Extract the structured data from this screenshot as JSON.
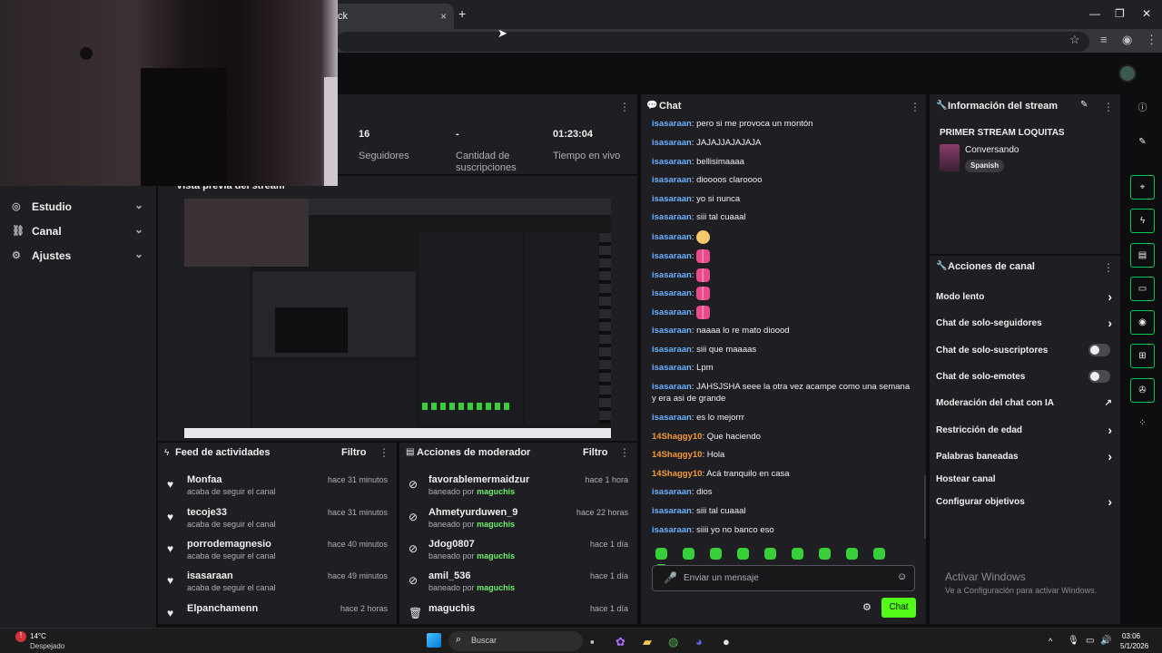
{
  "browser": {
    "tab_title": "ck",
    "tab_close": "×",
    "new_tab": "+",
    "window_controls": [
      "—",
      "❐",
      "✕"
    ]
  },
  "sidebar": {
    "items": [
      {
        "label": "Estudio",
        "icon": "broadcast-icon"
      },
      {
        "label": "Canal",
        "icon": "channel-icon"
      },
      {
        "label": "Ajustes",
        "icon": "gear-icon"
      }
    ]
  },
  "stats": [
    {
      "value": "16",
      "label": "Seguidores"
    },
    {
      "value": "-",
      "label": "Cantidad de suscripciones"
    },
    {
      "value": "01:23:04",
      "label": "Tiempo en vivo"
    }
  ],
  "preview": {
    "title": "Vista previa del stream"
  },
  "activity": {
    "title": "Feed de actividades",
    "filter": "Filtro",
    "items": [
      {
        "name": "Monfaa",
        "sub": "acaba de seguir el canal",
        "time": "hace 31 minutos"
      },
      {
        "name": "tecoje33",
        "sub": "acaba de seguir el canal",
        "time": "hace 31 minutos"
      },
      {
        "name": "porrodemagnesio",
        "sub": "acaba de seguir el canal",
        "time": "hace 40 minutos"
      },
      {
        "name": "isasaraan",
        "sub": "acaba de seguir el canal",
        "time": "hace 49 minutos"
      },
      {
        "name": "Elpanchamenn",
        "sub": "",
        "time": "hace 2 horas"
      }
    ]
  },
  "modactions": {
    "title": "Acciones de moderador",
    "filter": "Filtro",
    "banned_by": "baneado por",
    "items": [
      {
        "name": "favorablemermaidzur",
        "by": "maguchis",
        "time": "hace 1 hora"
      },
      {
        "name": "Ahmetyurduwen_9",
        "by": "maguchis",
        "time": "hace 22 horas"
      },
      {
        "name": "Jdog0807",
        "by": "maguchis",
        "time": "hace 1 día"
      },
      {
        "name": "amil_536",
        "by": "maguchis",
        "time": "hace 1 día"
      },
      {
        "name": "maguchis",
        "by": "",
        "time": "hace 1 día"
      }
    ]
  },
  "chat": {
    "title": "Chat",
    "placeholder": "Enviar un mensaje",
    "send_label": "Chat",
    "messages": [
      {
        "user": "isasaraan",
        "text": "pero si me provoca un montón",
        "color": "blue"
      },
      {
        "user": "isasaraan",
        "text": "JAJAJJAJAJAJA",
        "color": "blue"
      },
      {
        "user": "isasaraan",
        "text": "bellisimaaaa",
        "color": "blue"
      },
      {
        "user": "isasaraan",
        "text": "dioooos claroooo",
        "color": "blue"
      },
      {
        "user": "isasaraan",
        "text": "yo si nunca",
        "color": "blue"
      },
      {
        "user": "isasaraan",
        "text": "siii tal cuaaal",
        "color": "blue"
      },
      {
        "user": "isasaraan",
        "text": "",
        "emote": "face",
        "color": "blue"
      },
      {
        "user": "isasaraan",
        "text": "",
        "emote": "bow",
        "color": "blue"
      },
      {
        "user": "isasaraan",
        "text": "",
        "emote": "bow",
        "color": "blue"
      },
      {
        "user": "isasaraan",
        "text": "",
        "emote": "bow",
        "color": "blue"
      },
      {
        "user": "isasaraan",
        "text": "",
        "emote": "bow",
        "color": "blue"
      },
      {
        "user": "isasaraan",
        "text": "naaaa lo re mato dioood",
        "color": "blue"
      },
      {
        "user": "isasaraan",
        "text": "siii que maaaas",
        "color": "blue"
      },
      {
        "user": "isasaraan",
        "text": "Lpm",
        "color": "blue"
      },
      {
        "user": "isasaraan",
        "text": "JAHSJSHA seee la otra vez acampe como una semana y era asi de grande",
        "color": "blue"
      },
      {
        "user": "isasaraan",
        "text": "es lo mejorrr",
        "color": "blue"
      },
      {
        "user": "14Shaggy10",
        "text": "Que haciendo",
        "color": "orange"
      },
      {
        "user": "14Shaggy10",
        "text": "Hola",
        "color": "orange"
      },
      {
        "user": "14Shaggy10",
        "text": "Acá tranquilo en casa",
        "color": "orange"
      },
      {
        "user": "isasaraan",
        "text": "dios",
        "color": "blue"
      },
      {
        "user": "isasaraan",
        "text": "siii tal cuaaal",
        "color": "blue"
      },
      {
        "user": "isasaraan",
        "text": "siiii yo no banco eso",
        "color": "blue"
      }
    ]
  },
  "streaminfo": {
    "title": "Información del stream",
    "stream_title": "PRIMER STREAM LOQUITAS",
    "category": "Conversando",
    "language": "Spanish"
  },
  "channel_actions": {
    "title": "Acciones de canal",
    "items": [
      {
        "label": "Modo lento",
        "control": "arrow"
      },
      {
        "label": "Chat de solo-seguidores",
        "control": "arrow"
      },
      {
        "label": "Chat de solo-suscriptores",
        "control": "toggle"
      },
      {
        "label": "Chat de solo-emotes",
        "control": "toggle"
      },
      {
        "label": "Moderación del chat con IA",
        "control": "external"
      },
      {
        "label": "Restricción de edad",
        "control": "arrow"
      },
      {
        "label": "Palabras baneadas",
        "control": "arrow"
      },
      {
        "label": "Hostear canal",
        "control": "none"
      },
      {
        "label": "Configurar objetivos",
        "control": "arrow"
      }
    ]
  },
  "watermark": {
    "line1": "Activar Windows",
    "line2": "Ve a Configuración para activar Windows."
  },
  "taskbar": {
    "temp": "14°C",
    "weather": "Despejado",
    "search": "Buscar",
    "time": "03:06",
    "date": "5/1/2026"
  },
  "colors": {
    "accent": "#53fc18",
    "panel": "#1f1f23",
    "bg": "#0e0e10",
    "user_blue": "#6ab0ff",
    "user_orange": "#f59a32"
  }
}
